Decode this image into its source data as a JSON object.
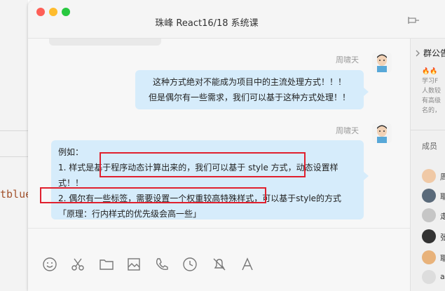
{
  "background": {
    "code_fragment": "tblue"
  },
  "window": {
    "title": "珠峰 React16/18 系统课"
  },
  "messages": [
    {
      "sender": "周啸天",
      "lines": [
        "这种方式绝对不能成为项目中的主流处理方式！！！",
        "但是偶尔有一些需求，我们可以基于这种方式处理！！"
      ]
    },
    {
      "sender": "周啸天",
      "lines": [
        "例如：",
        "1. 样式是基于程序动态计算出来的，我们可以基于 style 方式，动态设置样",
        "式！！",
        "2. 偶尔有一些标签，需要设置一个权重较高特殊样式，可以基于style的方式",
        "「原理：行内样式的优先级会高一些」"
      ]
    }
  ],
  "highlight_color": "#e0202e",
  "bubble_color": "#d6ecfb",
  "toolbar": {
    "icons": [
      "emoji-icon",
      "scissors-icon",
      "folder-icon",
      "image-icon",
      "phone-icon",
      "clock-icon",
      "bell-icon",
      "font-icon"
    ]
  },
  "right_panel": {
    "announcement_title": "群公告",
    "announcement_lines": [
      "学习F",
      "人数较",
      "有高级",
      "名的，"
    ],
    "members_title": "成员",
    "members": [
      "周",
      "耶",
      "走",
      "张",
      "耶",
      "a"
    ]
  }
}
